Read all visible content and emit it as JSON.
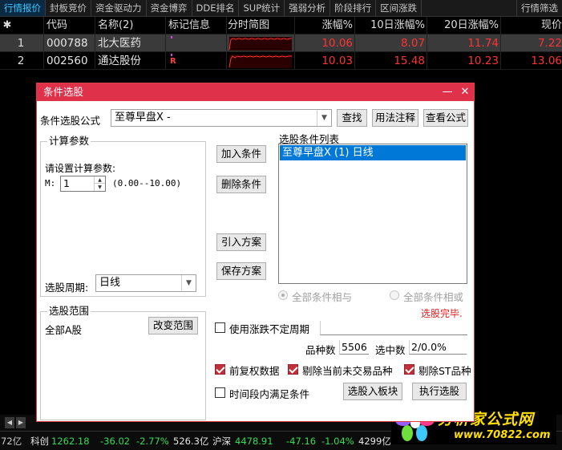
{
  "tabs": [
    "行情报价",
    "封板竞价",
    "资金驱动力",
    "资金博弈",
    "DDE排名",
    "SUP统计",
    "强弱分析",
    "阶段排行",
    "区间涨跌",
    "行情筛选"
  ],
  "table": {
    "headers": {
      "star": "✱",
      "code": "代码",
      "name": "名称(2)",
      "mark": "标记信息",
      "spark": "分时简图",
      "chg": "涨幅%",
      "chg10": "10日涨幅%",
      "chg20": "20日涨幅%",
      "price": "现价"
    },
    "rows": [
      {
        "no": "1",
        "code": "000788",
        "name": "北大医药",
        "chg": "10.06",
        "chg10": "8.07",
        "chg20": "11.74",
        "price": "7.22",
        "mark_r": ""
      },
      {
        "no": "2",
        "code": "002560",
        "name": "通达股份",
        "chg": "10.03",
        "chg10": "15.48",
        "chg20": "10.23",
        "price": "13.06",
        "mark_r": "R"
      }
    ]
  },
  "status": {
    "s0": "72亿",
    "s1": "科创",
    "s2": "1262.18",
    "s3": "-36.02",
    "s4": "-2.77%",
    "s5": "526.3亿",
    "s6": "沪深",
    "s7": "4478.91",
    "s8": "-47.16",
    "s9": "-1.04%",
    "s10": "4299亿"
  },
  "logo": {
    "main": "分析家公式网",
    "url": "www.70822.com"
  },
  "dialog": {
    "title": "条件选股",
    "formula_label": "条件选股公式",
    "formula_value": "至尊早盘X  -",
    "btn_find": "查找",
    "btn_usage": "用法注释",
    "btn_view": "查看公式",
    "params_group": "计算参数",
    "params_prompt": "请设置计算参数:",
    "param_name": "M:",
    "param_value": "1",
    "param_range": "(0.00--10.00)",
    "period_label": "选股周期:",
    "period_value": "日线",
    "btn_add": "加入条件",
    "btn_delete": "删除条件",
    "btn_import": "引入方案",
    "btn_save": "保存方案",
    "list_label": "选股条件列表",
    "list_items": [
      "至尊早盘X (1) 日线"
    ],
    "radio_and": "全部条件相与",
    "radio_or": "全部条件相或",
    "done_text": "选股完毕.",
    "range_group": "选股范围",
    "range_value": "全部A股",
    "btn_change_range": "改变范围",
    "use_period_label": "使用涨跌不定周期",
    "count_label": "品种数",
    "count_value": "5506",
    "selected_label": "选中数",
    "selected_value": "2/0.0%",
    "chk_prefq": "前复权数据",
    "chk_exclude_untraded": "剔除当前未交易品种",
    "chk_exclude_st": "剔除ST品种",
    "chk_time_range": "时间段内满足条件",
    "btn_to_block": "选股入板块",
    "btn_execute": "执行选股"
  }
}
